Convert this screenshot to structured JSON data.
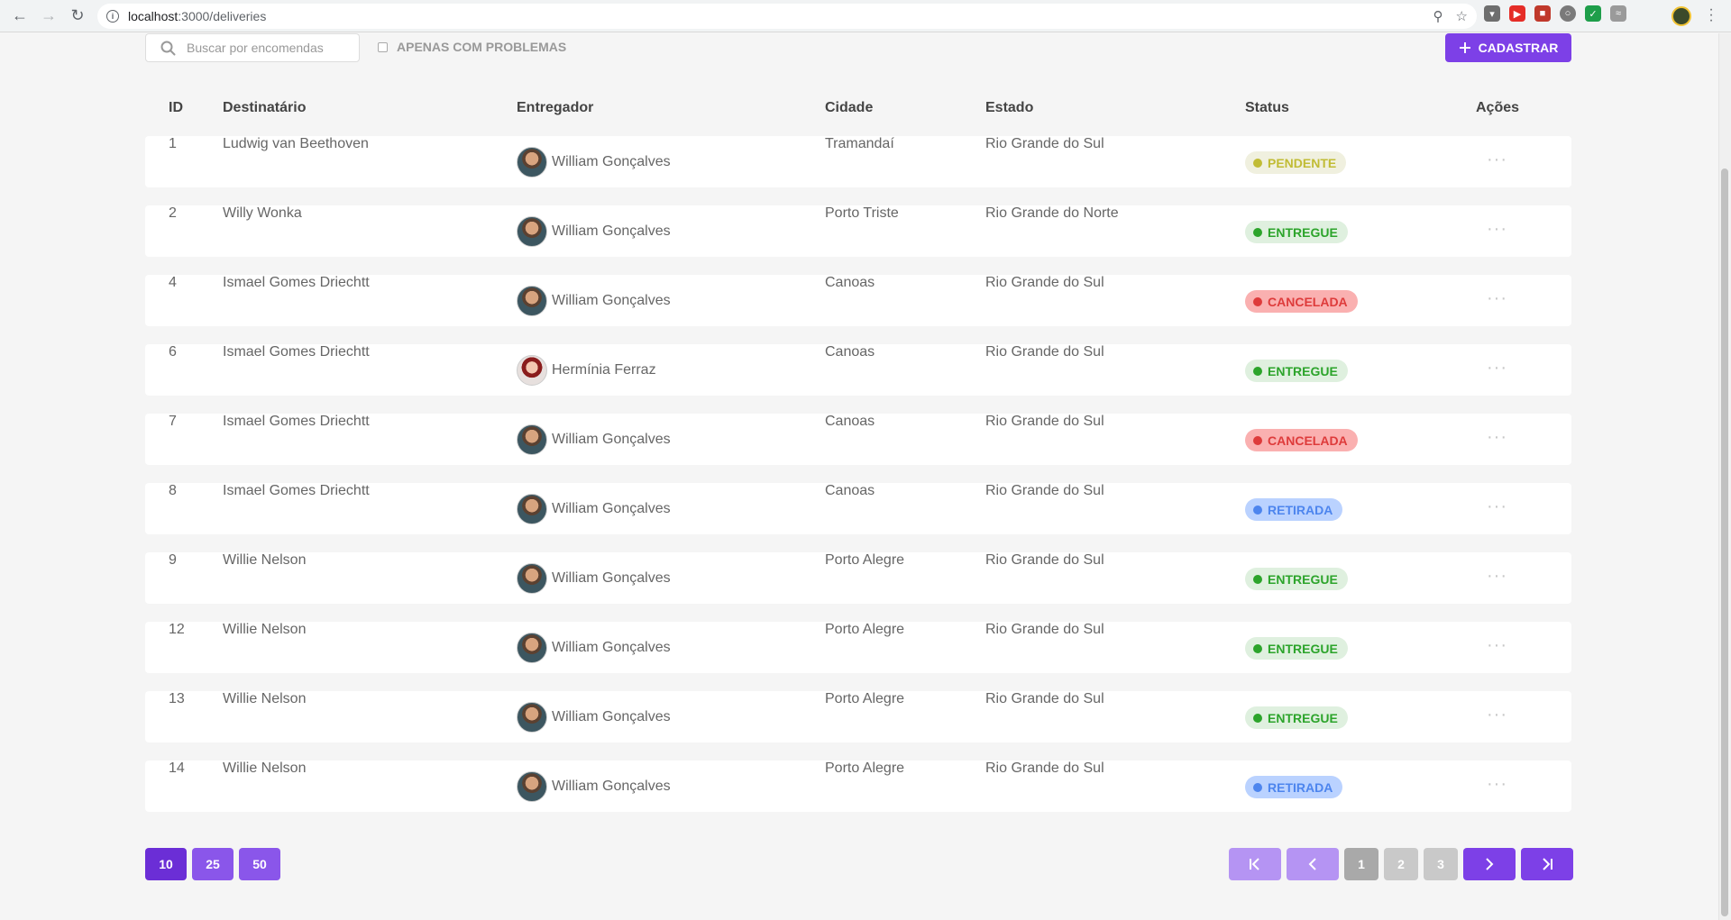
{
  "browser": {
    "url_host": "localhost",
    "url_path": ":3000/deliveries"
  },
  "toolbar": {
    "search_placeholder": "Buscar por encomendas",
    "filter_label": "APENAS COM PROBLEMAS",
    "add_label": "CADASTRAR"
  },
  "table": {
    "headers": [
      "ID",
      "Destinatário",
      "Entregador",
      "Cidade",
      "Estado",
      "Status",
      "Ações"
    ],
    "rows": [
      {
        "id": "1",
        "recipient": "Ludwig van Beethoven",
        "deliverer": "William Gonçalves",
        "city": "Tramandaí",
        "state": "Rio Grande do Sul",
        "status": "PENDENTE",
        "status_type": "pending"
      },
      {
        "id": "2",
        "recipient": "Willy Wonka",
        "deliverer": "William Gonçalves",
        "city": "Porto Triste",
        "state": "Rio Grande do Norte",
        "status": "ENTREGUE",
        "status_type": "delivered"
      },
      {
        "id": "4",
        "recipient": "Ismael Gomes Driechtt",
        "deliverer": "William Gonçalves",
        "city": "Canoas",
        "state": "Rio Grande do Sul",
        "status": "CANCELADA",
        "status_type": "canceled"
      },
      {
        "id": "6",
        "recipient": "Ismael Gomes Driechtt",
        "deliverer": "Hermínia Ferraz",
        "city": "Canoas",
        "state": "Rio Grande do Sul",
        "status": "ENTREGUE",
        "status_type": "delivered"
      },
      {
        "id": "7",
        "recipient": "Ismael Gomes Driechtt",
        "deliverer": "William Gonçalves",
        "city": "Canoas",
        "state": "Rio Grande do Sul",
        "status": "CANCELADA",
        "status_type": "canceled"
      },
      {
        "id": "8",
        "recipient": "Ismael Gomes Driechtt",
        "deliverer": "William Gonçalves",
        "city": "Canoas",
        "state": "Rio Grande do Sul",
        "status": "RETIRADA",
        "status_type": "withdrawn"
      },
      {
        "id": "9",
        "recipient": "Willie Nelson",
        "deliverer": "William Gonçalves",
        "city": "Porto Alegre",
        "state": "Rio Grande do Sul",
        "status": "ENTREGUE",
        "status_type": "delivered"
      },
      {
        "id": "12",
        "recipient": "Willie Nelson",
        "deliverer": "William Gonçalves",
        "city": "Porto Alegre",
        "state": "Rio Grande do Sul",
        "status": "ENTREGUE",
        "status_type": "delivered"
      },
      {
        "id": "13",
        "recipient": "Willie Nelson",
        "deliverer": "William Gonçalves",
        "city": "Porto Alegre",
        "state": "Rio Grande do Sul",
        "status": "ENTREGUE",
        "status_type": "delivered"
      },
      {
        "id": "14",
        "recipient": "Willie Nelson",
        "deliverer": "William Gonçalves",
        "city": "Porto Alegre",
        "state": "Rio Grande do Sul",
        "status": "RETIRADA",
        "status_type": "withdrawn"
      }
    ],
    "actions_glyph": "···"
  },
  "status_colors": {
    "pending": {
      "bg": "#f0f0df",
      "fg": "#c1bc35"
    },
    "delivered": {
      "bg": "#dff0df",
      "fg": "#2ca42b"
    },
    "canceled": {
      "bg": "#fab0b0",
      "fg": "#de3b3b"
    },
    "withdrawn": {
      "bg": "#bad2ff",
      "fg": "#4d85ee"
    }
  },
  "pagination": {
    "page_sizes": [
      "10",
      "25",
      "50"
    ],
    "active_page_size": "10",
    "pages": [
      "1",
      "2",
      "3"
    ],
    "current_page": "1"
  },
  "colors": {
    "accent": "#7d40e7",
    "background": "#f5f5f5"
  }
}
